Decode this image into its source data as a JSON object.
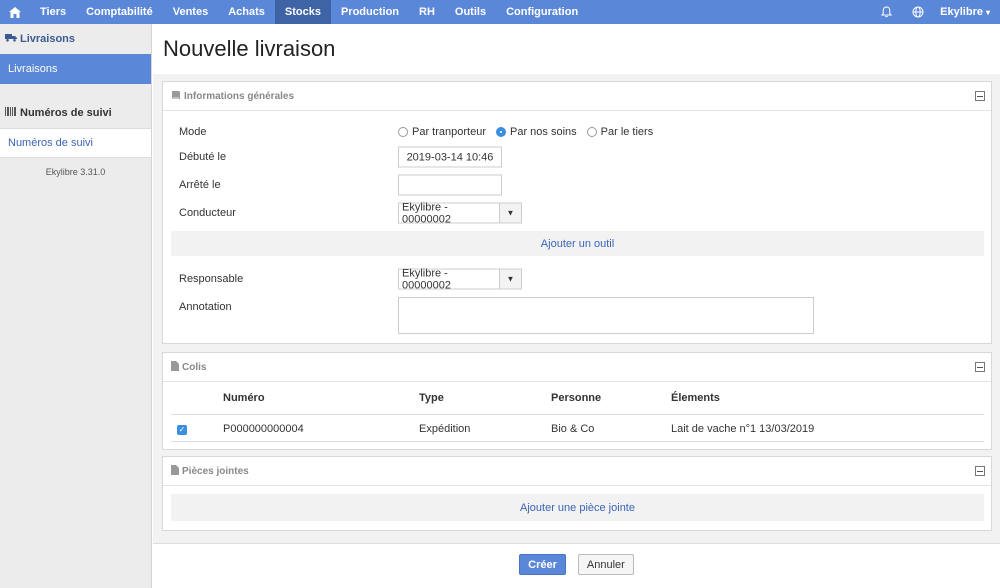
{
  "nav": {
    "items": [
      "Tiers",
      "Comptabilité",
      "Ventes",
      "Achats",
      "Stocks",
      "Production",
      "RH",
      "Outils",
      "Configuration"
    ],
    "active": "Stocks",
    "user": "Ekylibre"
  },
  "sidebar": {
    "section1": "Livraisons",
    "item1": "Livraisons",
    "section2": "Numéros de suivi",
    "item2": "Numéros de suivi",
    "version": "Ekylibre 3.31.0"
  },
  "page": {
    "title": "Nouvelle livraison"
  },
  "general": {
    "title": "Informations générales",
    "mode_label": "Mode",
    "mode_options": [
      "Par tranporteur",
      "Par nos soins",
      "Par le tiers"
    ],
    "mode_selected": "Par nos soins",
    "started_label": "Débuté le",
    "started_value": "2019-03-14 10:46",
    "stopped_label": "Arrêté le",
    "stopped_value": "",
    "driver_label": "Conducteur",
    "driver_value": "Ekylibre - 00000002",
    "add_tool": "Ajouter un outil",
    "responsible_label": "Responsable",
    "responsible_value": "Ekylibre - 00000002",
    "annotation_label": "Annotation",
    "annotation_value": ""
  },
  "colis": {
    "title": "Colis",
    "columns": [
      "Numéro",
      "Type",
      "Personne",
      "Élements"
    ],
    "rows": [
      {
        "checked": true,
        "numero": "P000000000004",
        "type": "Expédition",
        "personne": "Bio & Co",
        "elements": "Lait de vache n°1 13/03/2019"
      }
    ]
  },
  "attachments": {
    "title": "Pièces jointes",
    "add_label": "Ajouter une pièce jointe"
  },
  "actions": {
    "create": "Créer",
    "cancel": "Annuler"
  },
  "colors": {
    "nav": "#5b87d8",
    "nav_active": "#3e64a6",
    "link": "#3a64b8",
    "radio_on": "#3b8fe0"
  }
}
